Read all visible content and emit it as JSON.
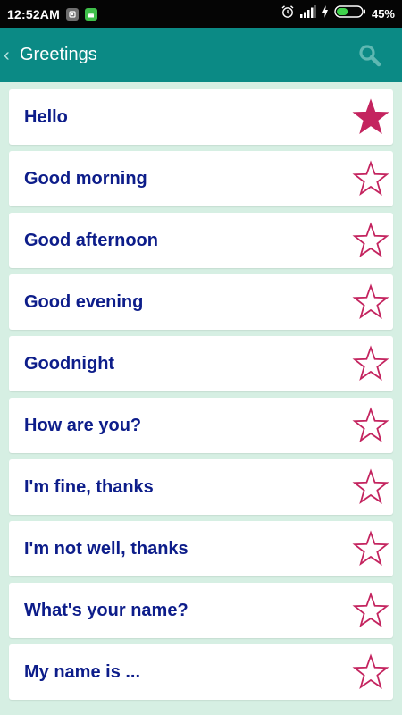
{
  "status_bar": {
    "time": "12:52AM",
    "battery_percent": "45%",
    "battery_level": 0.45,
    "icons": [
      "notification-app-icon",
      "notification-android-icon",
      "alarm-icon",
      "signal-icon",
      "charging-icon",
      "battery-icon"
    ]
  },
  "app_bar": {
    "back_glyph": "‹",
    "title": "Greetings",
    "search_icon": "search-icon"
  },
  "colors": {
    "app_bar": "#0b8a85",
    "background": "#d6efe3",
    "phrase_text": "#0d1d8a",
    "star": "#c4245f"
  },
  "phrases": [
    {
      "label": "Hello",
      "favorite": true
    },
    {
      "label": "Good morning",
      "favorite": false
    },
    {
      "label": "Good afternoon",
      "favorite": false
    },
    {
      "label": "Good evening",
      "favorite": false
    },
    {
      "label": "Goodnight",
      "favorite": false
    },
    {
      "label": "How are you?",
      "favorite": false
    },
    {
      "label": "I'm fine, thanks",
      "favorite": false
    },
    {
      "label": "I'm not well, thanks",
      "favorite": false
    },
    {
      "label": "What's your name?",
      "favorite": false
    },
    {
      "label": "My name is ...",
      "favorite": false
    }
  ]
}
